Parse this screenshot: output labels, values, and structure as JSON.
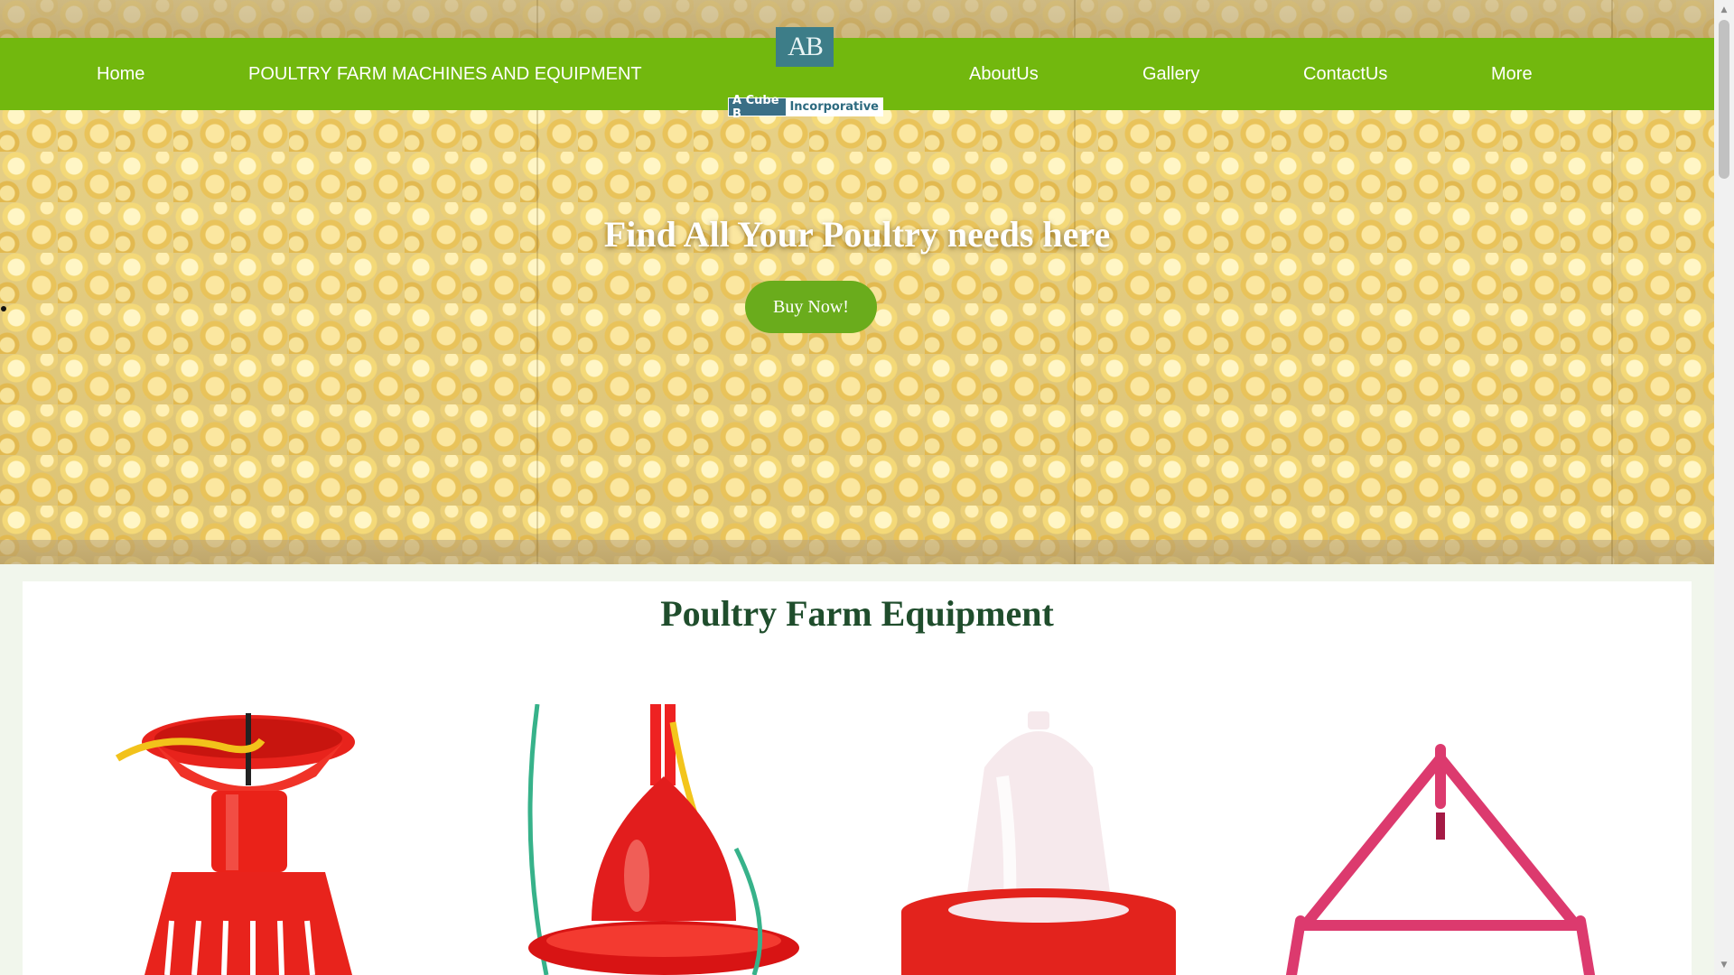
{
  "nav": {
    "items": [
      {
        "label": "Home"
      },
      {
        "label": "POULTRY FARM MACHINES AND EQUIPMENT"
      },
      {
        "label": "AboutUs"
      },
      {
        "label": "Gallery"
      },
      {
        "label": "ContactUs"
      },
      {
        "label": "More"
      }
    ]
  },
  "logo": {
    "mark": "AB",
    "text_a": "A Cube B",
    "text_b": "Incorporative"
  },
  "hero": {
    "title": "Find All Your Poultry needs here",
    "button_label": "Buy Now!"
  },
  "section": {
    "title": "Poultry Farm Equipment"
  },
  "products": [
    {
      "name": "red-poultry-feeder",
      "color": "#e8231c"
    },
    {
      "name": "red-bell-drinker",
      "color": "#e21d1d"
    },
    {
      "name": "white-chick-drinker",
      "color": "#f6e9ec"
    },
    {
      "name": "pink-tripod-stand",
      "color": "#dc3a6e"
    }
  ],
  "colors": {
    "nav_green": "#72b80e",
    "button_green": "#6aac1c",
    "title_green": "#1f4d2c",
    "logo_teal": "#3d7d88"
  }
}
